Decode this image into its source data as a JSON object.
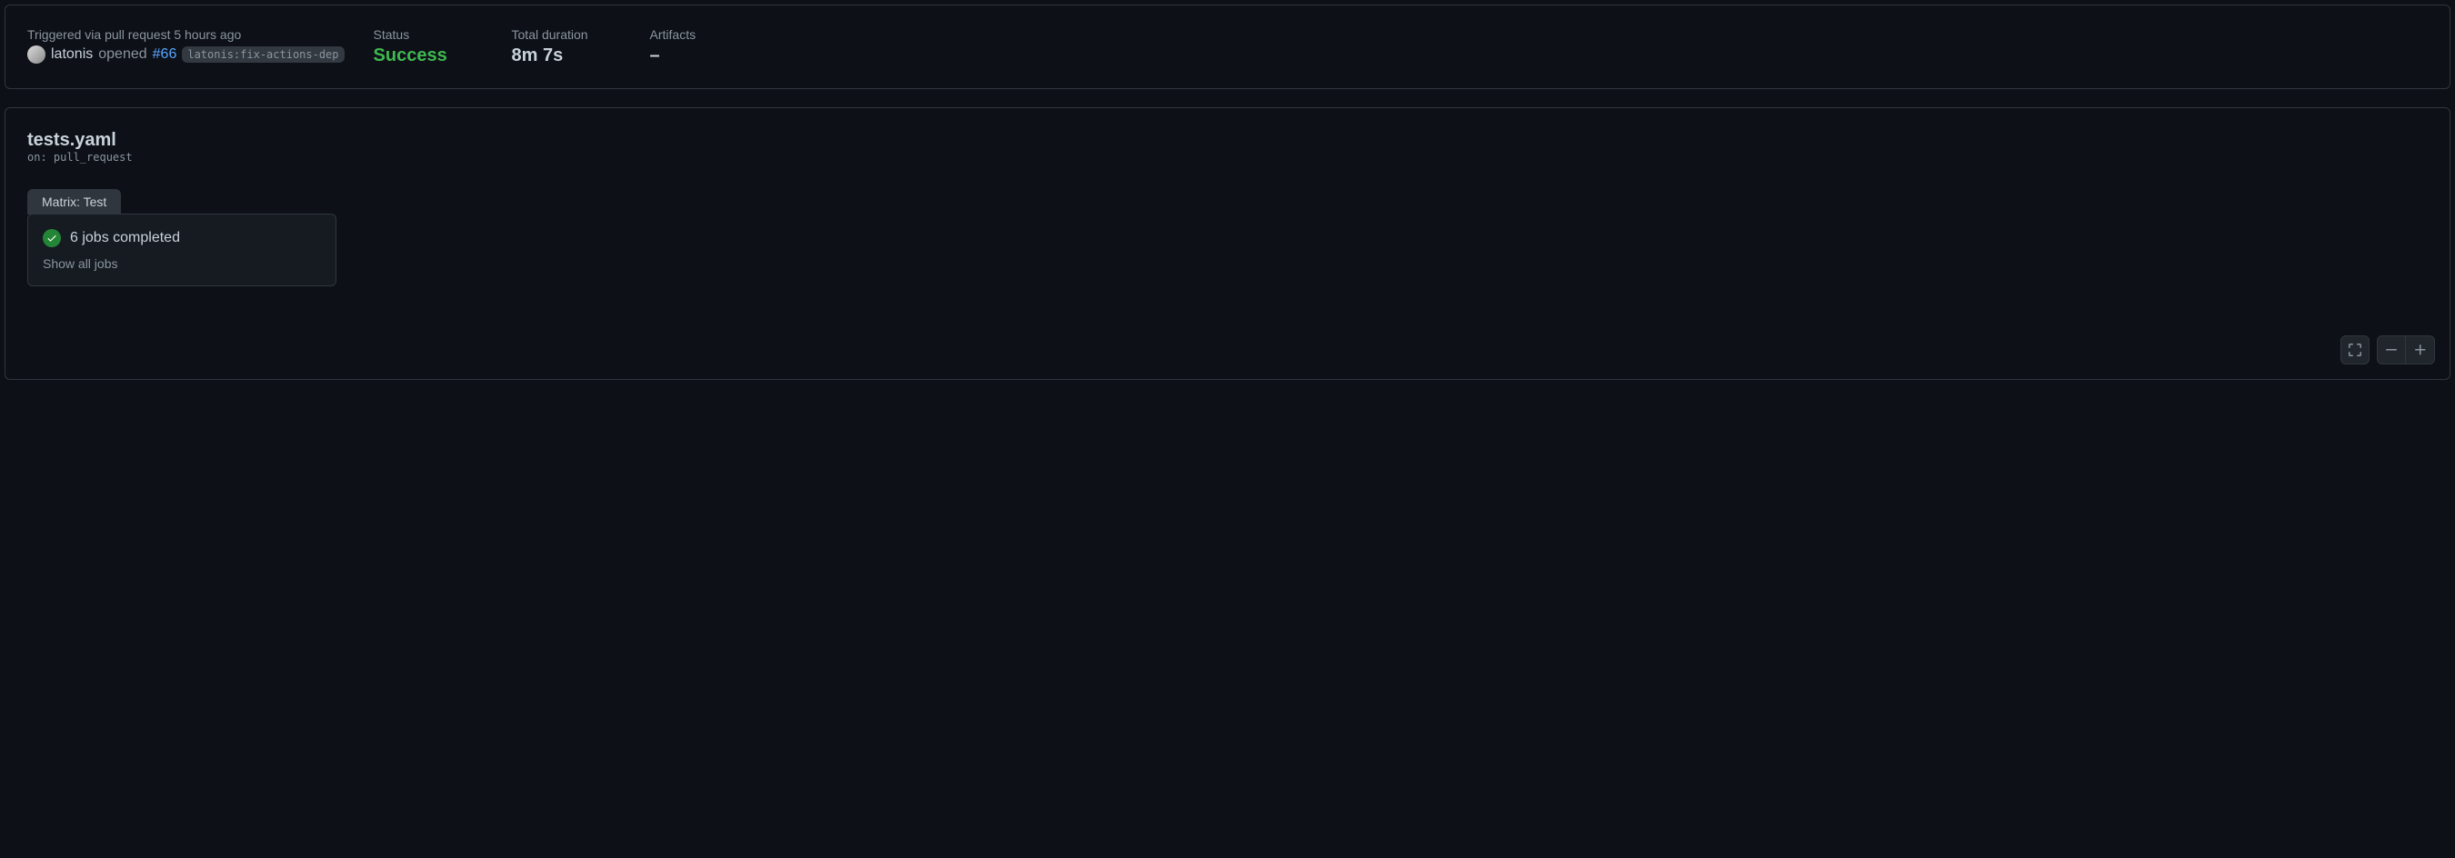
{
  "trigger": {
    "label": "Triggered via pull request 5 hours ago",
    "username": "latonis",
    "action_text": "opened",
    "pr_number": "#66",
    "branch": "latonis:fix-actions-dep"
  },
  "stats": {
    "status_label": "Status",
    "status_value": "Success",
    "duration_label": "Total duration",
    "duration_value": "8m 7s",
    "artifacts_label": "Artifacts",
    "artifacts_value": "–"
  },
  "workflow": {
    "title": "tests.yaml",
    "subtitle": "on: pull_request",
    "matrix_label": "Matrix: Test",
    "job_summary": "6 jobs completed",
    "show_all": "Show all jobs"
  }
}
